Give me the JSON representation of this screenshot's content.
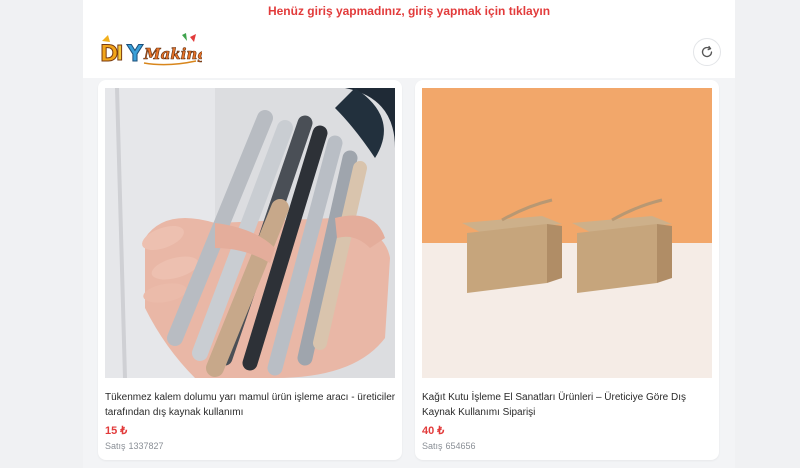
{
  "header": {
    "login_notice": "Henüz giriş yapmadınız, giriş yapmak için tıklayın",
    "logo_text": "DIY Making"
  },
  "products": [
    {
      "title": "Tükenmez kalem dolumu yarı mamul ürün işleme aracı - üreticiler tarafından dış kaynak kullanımı",
      "price": "15 ₺",
      "sales_label": "Satış",
      "sales_count": "1337827"
    },
    {
      "title": "Kağıt Kutu İşleme El Sanatları Ürünleri – Üreticiye Göre Dış Kaynak Kullanımı Siparişi",
      "price": "40 ₺",
      "sales_label": "Satış",
      "sales_count": "654656"
    }
  ],
  "colors": {
    "accent_red": "#e23b3b",
    "page_bg": "#f0f1f3"
  }
}
